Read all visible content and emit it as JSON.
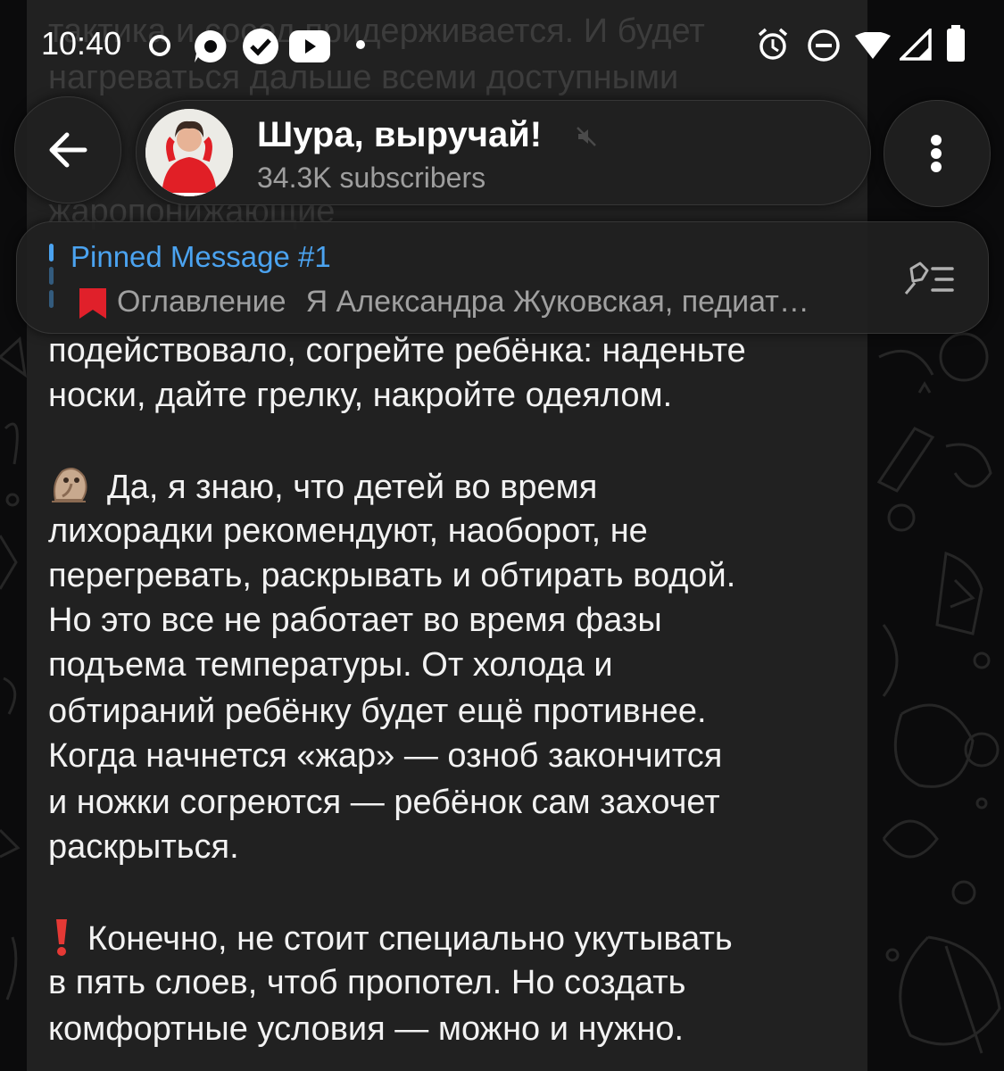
{
  "status_bar": {
    "time": "10:40"
  },
  "header": {
    "channel_name": "Шура, выручай!",
    "subscribers": "34.3K subscribers"
  },
  "pinned": {
    "title": "Pinned Message #1",
    "preview_title": "Оглавление",
    "preview_text": "Я Александра Жуковская, педиат…"
  },
  "message": {
    "ghost_lines": [
      "тактика и сосед придерживается. И будет",
      "нагреваться дальше всеми доступными",
      "жаропонижающие"
    ],
    "p1": [
      "подействовало, согрейте ребёнка: наденьте",
      "носки, дайте грелку, накройте одеялом."
    ],
    "p2": [
      "Да, я знаю, что детей во время",
      "лихорадки рекомендуют, наоборот, не",
      "перегревать, раскрывать и обтирать водой.",
      "Но это все не работает во время фазы",
      "подъема температуры. От холода и",
      "обтираний ребёнку будет ещё противнее.",
      "Когда начнется «жар» — озноб закончится",
      "и ножки согреются — ребёнок сам захочет",
      "раскрыться."
    ],
    "p3": [
      "Конечно, не стоит специально укутывать",
      "в пять слоев, чтоб пропотел. Но создать",
      "комфортные условия — можно и нужно."
    ]
  },
  "colors": {
    "accent": "#4ba3f0",
    "bubble": "#212121",
    "background": "#0b0b0c",
    "secondary_text": "#9e9e9e"
  }
}
